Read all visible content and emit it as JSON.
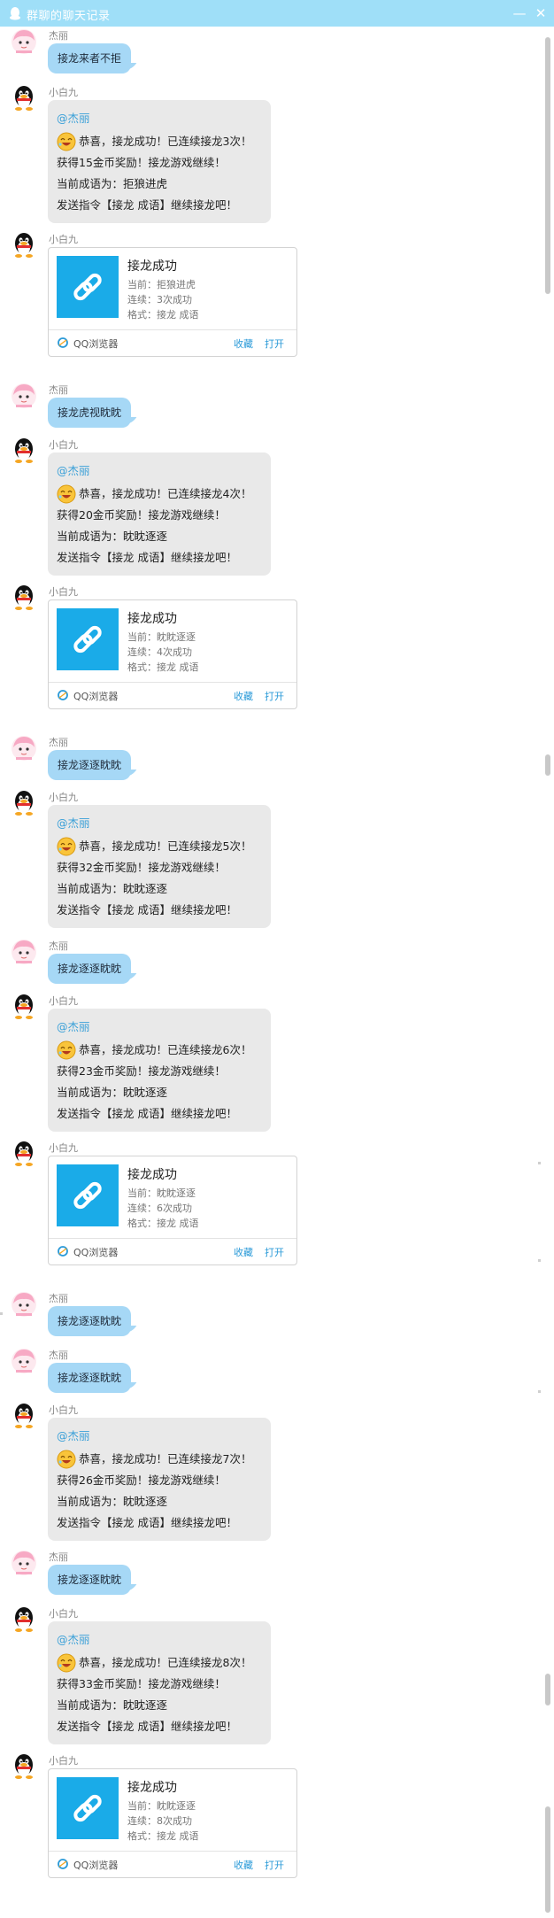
{
  "window": {
    "title": "群聊的聊天记录",
    "minimize_glyph": "—",
    "close_glyph": "✕"
  },
  "users": {
    "user": "杰丽",
    "bot": "小白九"
  },
  "card_common": {
    "title": "接龙成功",
    "browser": "QQ浏览器",
    "favorite": "收藏",
    "open": "打开",
    "format": "格式：接龙 成语"
  },
  "messages": [
    {
      "kind": "user",
      "text": "接龙来者不拒"
    },
    {
      "kind": "bot_text",
      "mention": "@杰丽",
      "lines": [
        "恭喜，接龙成功！已连续接龙3次！",
        "获得15金币奖励！接龙游戏继续！",
        "当前成语为：拒狼进虎",
        "发送指令【接龙 成语】继续接龙吧！"
      ]
    },
    {
      "kind": "bot_card",
      "current": "当前：拒狼进虎",
      "streak": "连续：3次成功"
    },
    {
      "kind": "user",
      "text": "接龙虎视眈眈"
    },
    {
      "kind": "bot_text",
      "mention": "@杰丽",
      "lines": [
        "恭喜，接龙成功！已连续接龙4次！",
        "获得20金币奖励！接龙游戏继续！",
        "当前成语为：眈眈逐逐",
        "发送指令【接龙 成语】继续接龙吧！"
      ]
    },
    {
      "kind": "bot_card",
      "current": "当前：眈眈逐逐",
      "streak": "连续：4次成功"
    },
    {
      "kind": "user",
      "text": "接龙逐逐眈眈"
    },
    {
      "kind": "bot_text",
      "mention": "@杰丽",
      "lines": [
        "恭喜，接龙成功！已连续接龙5次！",
        "获得32金币奖励！接龙游戏继续！",
        "当前成语为：眈眈逐逐",
        "发送指令【接龙 成语】继续接龙吧！"
      ]
    },
    {
      "kind": "user",
      "text": "接龙逐逐眈眈"
    },
    {
      "kind": "bot_text",
      "mention": "@杰丽",
      "lines": [
        "恭喜，接龙成功！已连续接龙6次！",
        "获得23金币奖励！接龙游戏继续！",
        "当前成语为：眈眈逐逐",
        "发送指令【接龙 成语】继续接龙吧！"
      ]
    },
    {
      "kind": "bot_card",
      "current": "当前：眈眈逐逐",
      "streak": "连续：6次成功"
    },
    {
      "kind": "user",
      "text": "接龙逐逐眈眈"
    },
    {
      "kind": "user",
      "text": "接龙逐逐眈眈"
    },
    {
      "kind": "bot_text",
      "mention": "@杰丽",
      "lines": [
        "恭喜，接龙成功！已连续接龙7次！",
        "获得26金币奖励！接龙游戏继续！",
        "当前成语为：眈眈逐逐",
        "发送指令【接龙 成语】继续接龙吧！"
      ]
    },
    {
      "kind": "user",
      "text": "接龙逐逐眈眈"
    },
    {
      "kind": "bot_text",
      "mention": "@杰丽",
      "lines": [
        "恭喜，接龙成功！已连续接龙8次！",
        "获得33金币奖励！接龙游戏继续！",
        "当前成语为：眈眈逐逐",
        "发送指令【接龙 成语】继续接龙吧！"
      ]
    },
    {
      "kind": "bot_card",
      "current": "当前：眈眈逐逐",
      "streak": "连续：8次成功"
    }
  ],
  "icons": {
    "user_avatar": "anime-girl-avatar-icon",
    "bot_avatar": "qq-penguin-avatar-icon",
    "emoji": "laughing-emoji-icon",
    "link": "link-icon",
    "browser": "qq-browser-icon"
  },
  "colors": {
    "titlebar": "#9fdff8",
    "user_bubble": "#a6d8f6",
    "bot_bubble": "#e9e9e9",
    "card_thumb": "#1aabe8",
    "link_text": "#2a9ad8"
  }
}
